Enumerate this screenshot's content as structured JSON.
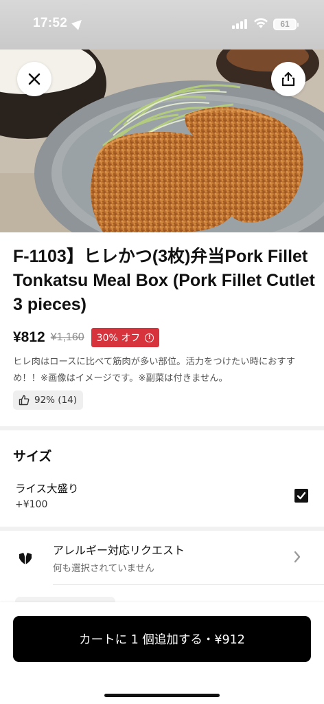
{
  "status_bar": {
    "time": "17:52",
    "battery": "61"
  },
  "icons": {
    "close": "close-icon",
    "share": "share-icon",
    "thumbs_up": "thumbs-up-icon",
    "allergy": "leaf-shield-icon",
    "chevron": "chevron-right-icon",
    "check": "checkmark-icon"
  },
  "item": {
    "title": "F-1103】ヒレかつ(3枚)弁当Pork Fillet Tonkatsu Meal Box (Pork Fillet Cutlet 3 pieces)",
    "price": "¥812",
    "original_price": "¥1,160",
    "discount": "30% オフ",
    "description": "ヒレ肉はロースに比べて筋肉が多い部位。活力をつけたい時におすすめ！！※画像はイメージです。※副菜は付きません。",
    "rating": "92% (14)"
  },
  "size_section": {
    "title": "サイズ",
    "option_name": "ライス大盛り",
    "option_price": "+¥100",
    "checked": true
  },
  "allergy": {
    "title": "アレルギー対応リクエスト",
    "subtitle": "何も選択されていません"
  },
  "cart_button": {
    "label": "カートに 1 個追加する・¥912"
  },
  "colors": {
    "discount_badge": "#d6333c",
    "cart_button": "#000000"
  }
}
